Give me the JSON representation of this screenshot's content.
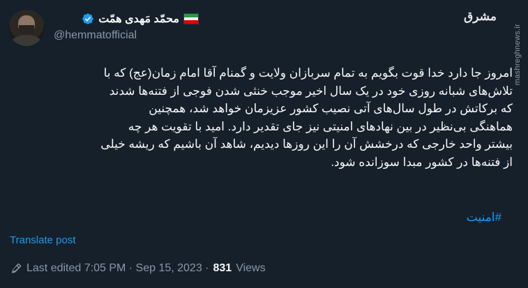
{
  "author": {
    "display_name": "محمّد مَهدی همّت",
    "handle": "@hemmatofficial",
    "flag_colors": [
      "#239f40",
      "#ffffff",
      "#da0000"
    ]
  },
  "watermark": {
    "logo_text": "مشرق",
    "site": "mashreghnews.ir"
  },
  "tweet": {
    "lines": [
      "امروز جا دارد خدا قوت بگویم به تمام سربازان ولایت و گمنام آقا امام زمان(عج) که با",
      "تلاش‌های شبانه روزی خود در یک سال اخیر موجب خنثی شدن فوجی از فتنه‌ها شدند",
      "که برکاتش در طول سال‌های آتی نصیب کشور عزیزمان خواهد شد، همچنین",
      "هماهنگی بی‌نظیر در بین نهادهای امنیتی نیز جای تقدیر دارد. امید با تقویت هر چه",
      "بیشتر واحد خارجی که درخشش آن را این روزها دیدیم، شاهد آن باشیم که ریشه خیلی",
      "از فتنه‌ها در کشور مبدا سوزانده شود."
    ],
    "hashtag": "#امنیت",
    "translate_label": "Translate post"
  },
  "meta": {
    "edited_label": "Last edited 7:05 PM · Sep 15, 2023 ·",
    "views_count": "831",
    "views_label": "Views"
  },
  "colors": {
    "background": "#15202b",
    "link": "#1d9bf0",
    "verified": "#1d9bf0",
    "secondary_text": "#8b98a5"
  }
}
